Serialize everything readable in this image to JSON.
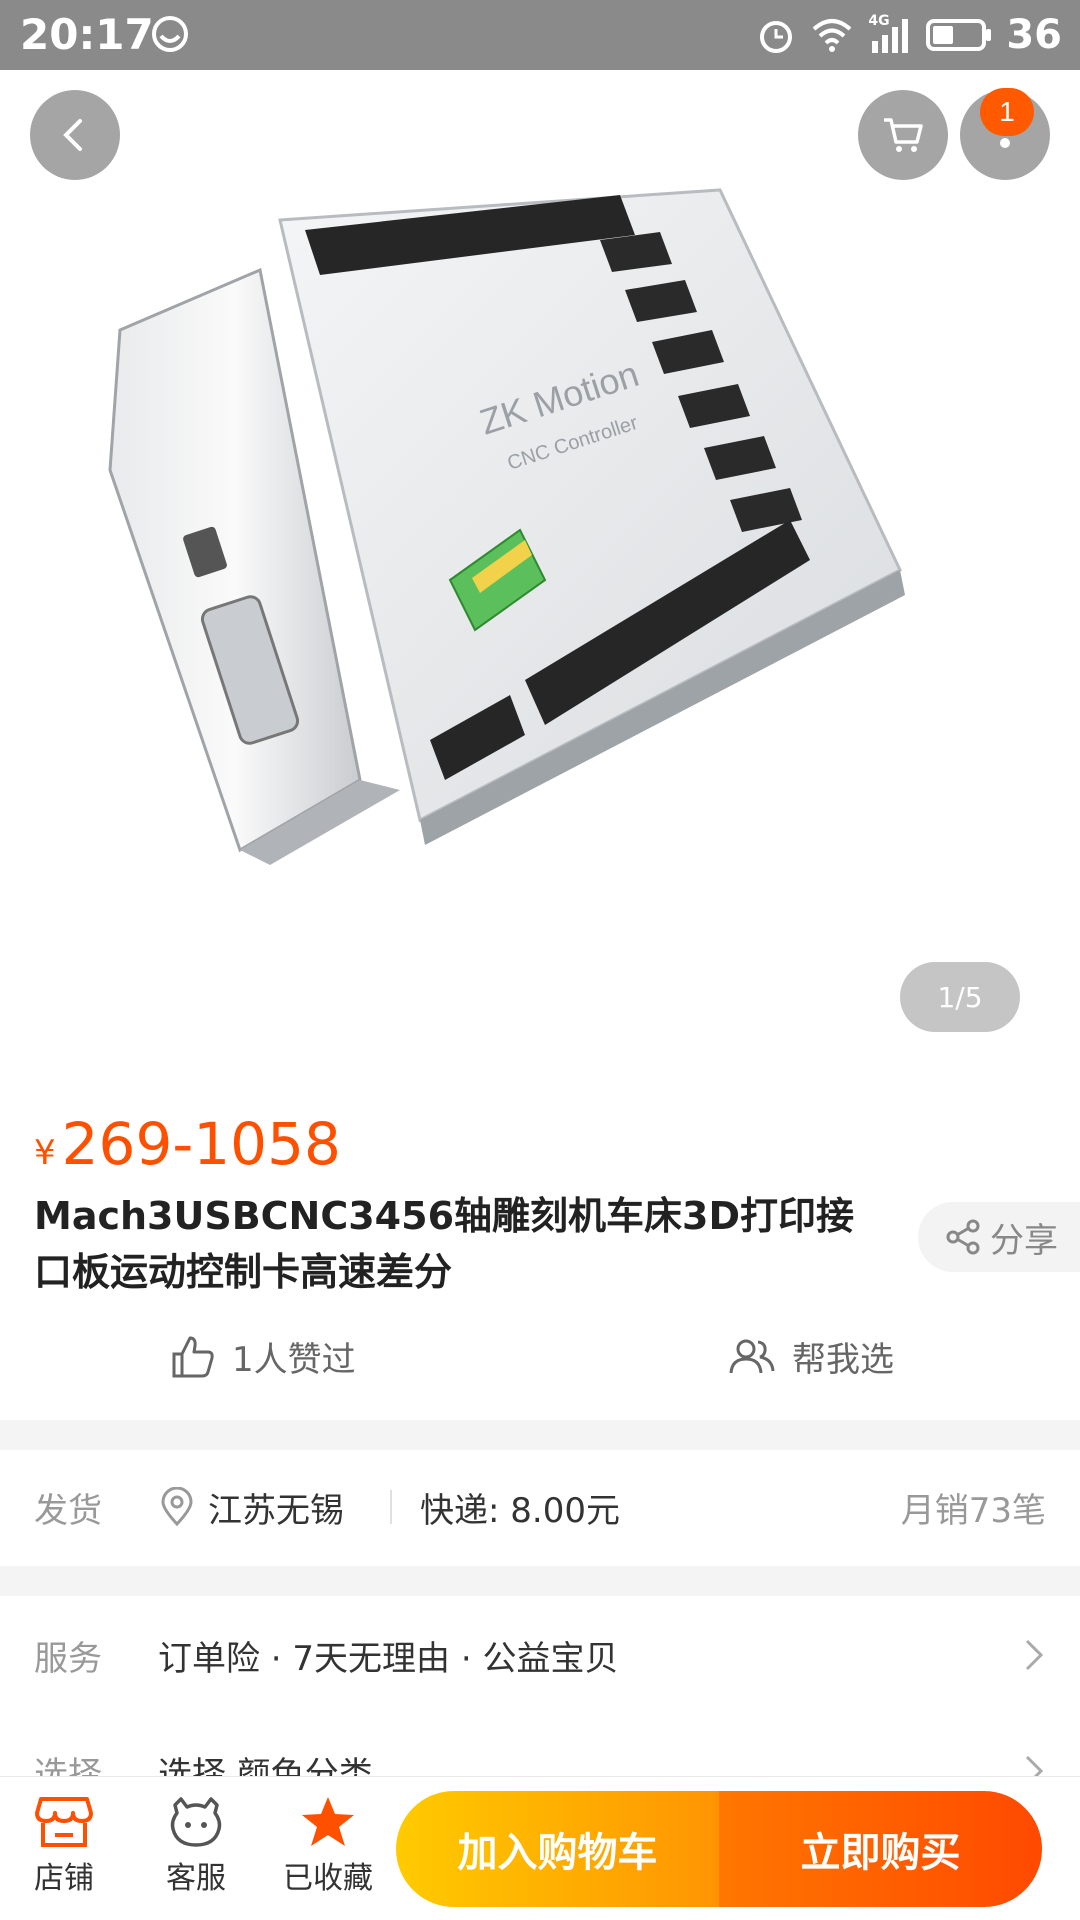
{
  "status_bar": {
    "time": "20:17",
    "network": "4G",
    "battery": "36"
  },
  "gallery": {
    "pager": "1/5",
    "cart_badge": "1"
  },
  "product": {
    "currency": "¥",
    "price": "269-1058",
    "title": "Mach3USBCNC3456轴雕刻机车床3D打印接口板运动控制卡高速差分",
    "share_label": "分享",
    "image_text": {
      "brand": "ZK Motion",
      "subtitle": "CNC Controller"
    }
  },
  "actions": {
    "like": "1人赞过",
    "help_choose": "帮我选"
  },
  "shipping": {
    "label": "发货",
    "location": "江苏无锡",
    "fee": "快递: 8.00元",
    "monthly_sales": "月销73笔"
  },
  "service": {
    "label": "服务",
    "value": "订单险 · 7天无理由 · 公益宝贝"
  },
  "select": {
    "label": "选择",
    "value": "选择 颜色分类"
  },
  "bottom_bar": {
    "shop": "店铺",
    "service": "客服",
    "favorite": "已收藏",
    "add_to_cart": "加入购物车",
    "buy_now": "立即购买"
  },
  "colors": {
    "accent": "#ff5000",
    "add_cart_start": "#ffcb00",
    "buy_now_end": "#ff4900"
  }
}
